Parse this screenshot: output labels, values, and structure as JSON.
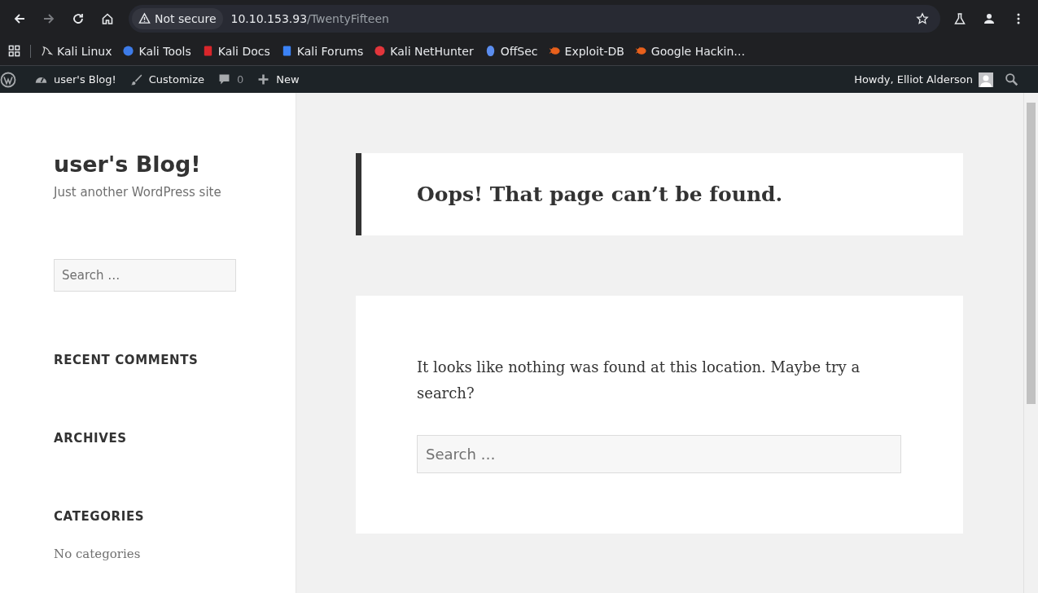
{
  "browser": {
    "security": "Not secure",
    "url_host": "10.10.153.93",
    "url_path": "/TwentyFifteen",
    "bookmarks": [
      {
        "label": "Kali Linux",
        "kind": "dragon"
      },
      {
        "label": "Kali Tools",
        "kind": "tools"
      },
      {
        "label": "Kali Docs",
        "kind": "docs"
      },
      {
        "label": "Kali Forums",
        "kind": "forums"
      },
      {
        "label": "Kali NetHunter",
        "kind": "nethunter"
      },
      {
        "label": "OffSec",
        "kind": "offsec"
      },
      {
        "label": "Exploit-DB",
        "kind": "bug"
      },
      {
        "label": "Google Hackin…",
        "kind": "bug"
      }
    ]
  },
  "admin_bar": {
    "site": "user's Blog!",
    "customize": "Customize",
    "comments": "0",
    "new": "New",
    "greeting": "Howdy, Elliot Alderson"
  },
  "sidebar": {
    "title": "user's Blog!",
    "tagline": "Just another WordPress site",
    "search": {
      "placeholder": "Search …"
    },
    "widgets": [
      {
        "title": "RECENT COMMENTS"
      },
      {
        "title": "ARCHIVES"
      },
      {
        "title": "CATEGORIES",
        "text": "No categories"
      }
    ]
  },
  "main": {
    "heading": "Oops! That page can’t be found.",
    "message": "It looks like nothing was found at this location. Maybe try a search?",
    "search": {
      "placeholder": "Search …"
    }
  }
}
